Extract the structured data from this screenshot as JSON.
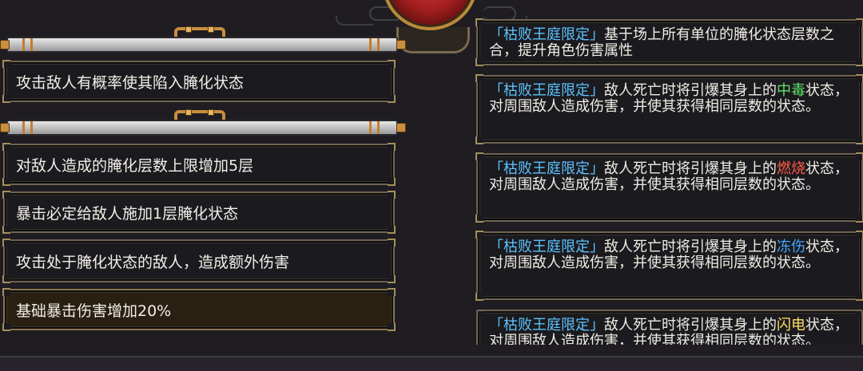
{
  "left_list": {
    "items": [
      {
        "label": "攻击敌人有概率使其陷入腌化状态",
        "selected": false
      },
      {
        "label": "对敌人造成的腌化层数上限增加5层",
        "selected": false
      },
      {
        "label": "暴击必定给敌人施加1层腌化状态",
        "selected": false
      },
      {
        "label": "攻击处于腌化状态的敌人，造成额外伤害",
        "selected": false
      },
      {
        "label": "基础暴击伤害增加20%",
        "selected": true
      }
    ]
  },
  "right_list": {
    "entries": [
      {
        "tag": "「枯败王庭限定」",
        "text_before": "基于场上所有单位的腌化状态层数之合，提升角色伤害属性",
        "keyword": "",
        "text_after": ""
      },
      {
        "tag": "「枯败王庭限定」",
        "text_before": "敌人死亡时将引爆其身上的",
        "keyword": "中毒",
        "keyword_color": "#5fe36b",
        "text_after": "状态，对周围敌人造成伤害，并使其获得相同层数的状态。"
      },
      {
        "tag": "「枯败王庭限定」",
        "text_before": "敌人死亡时将引爆其身上的",
        "keyword": "燃烧",
        "keyword_color": "#ff5c4a",
        "text_after": "状态，对周围敌人造成伤害，并使其获得相同层数的状态。"
      },
      {
        "tag": "「枯败王庭限定」",
        "text_before": "敌人死亡时将引爆其身上的",
        "keyword": "冻伤",
        "keyword_color": "#43a7ff",
        "text_after": "状态，对周围敌人造成伤害，并使其获得相同层数的状态。"
      },
      {
        "tag": "「枯败王庭限定」",
        "text_before": "敌人死亡时将引爆其身上的",
        "keyword": "闪电",
        "keyword_color": "#ffe066",
        "text_after": "状态，对周围敌人造成伤害，并使其获得相同层数的状态。"
      }
    ]
  },
  "colors": {
    "tag": "#5cc3ff",
    "panel_border": "#6f6551",
    "selected_bg": "#2a2012"
  }
}
